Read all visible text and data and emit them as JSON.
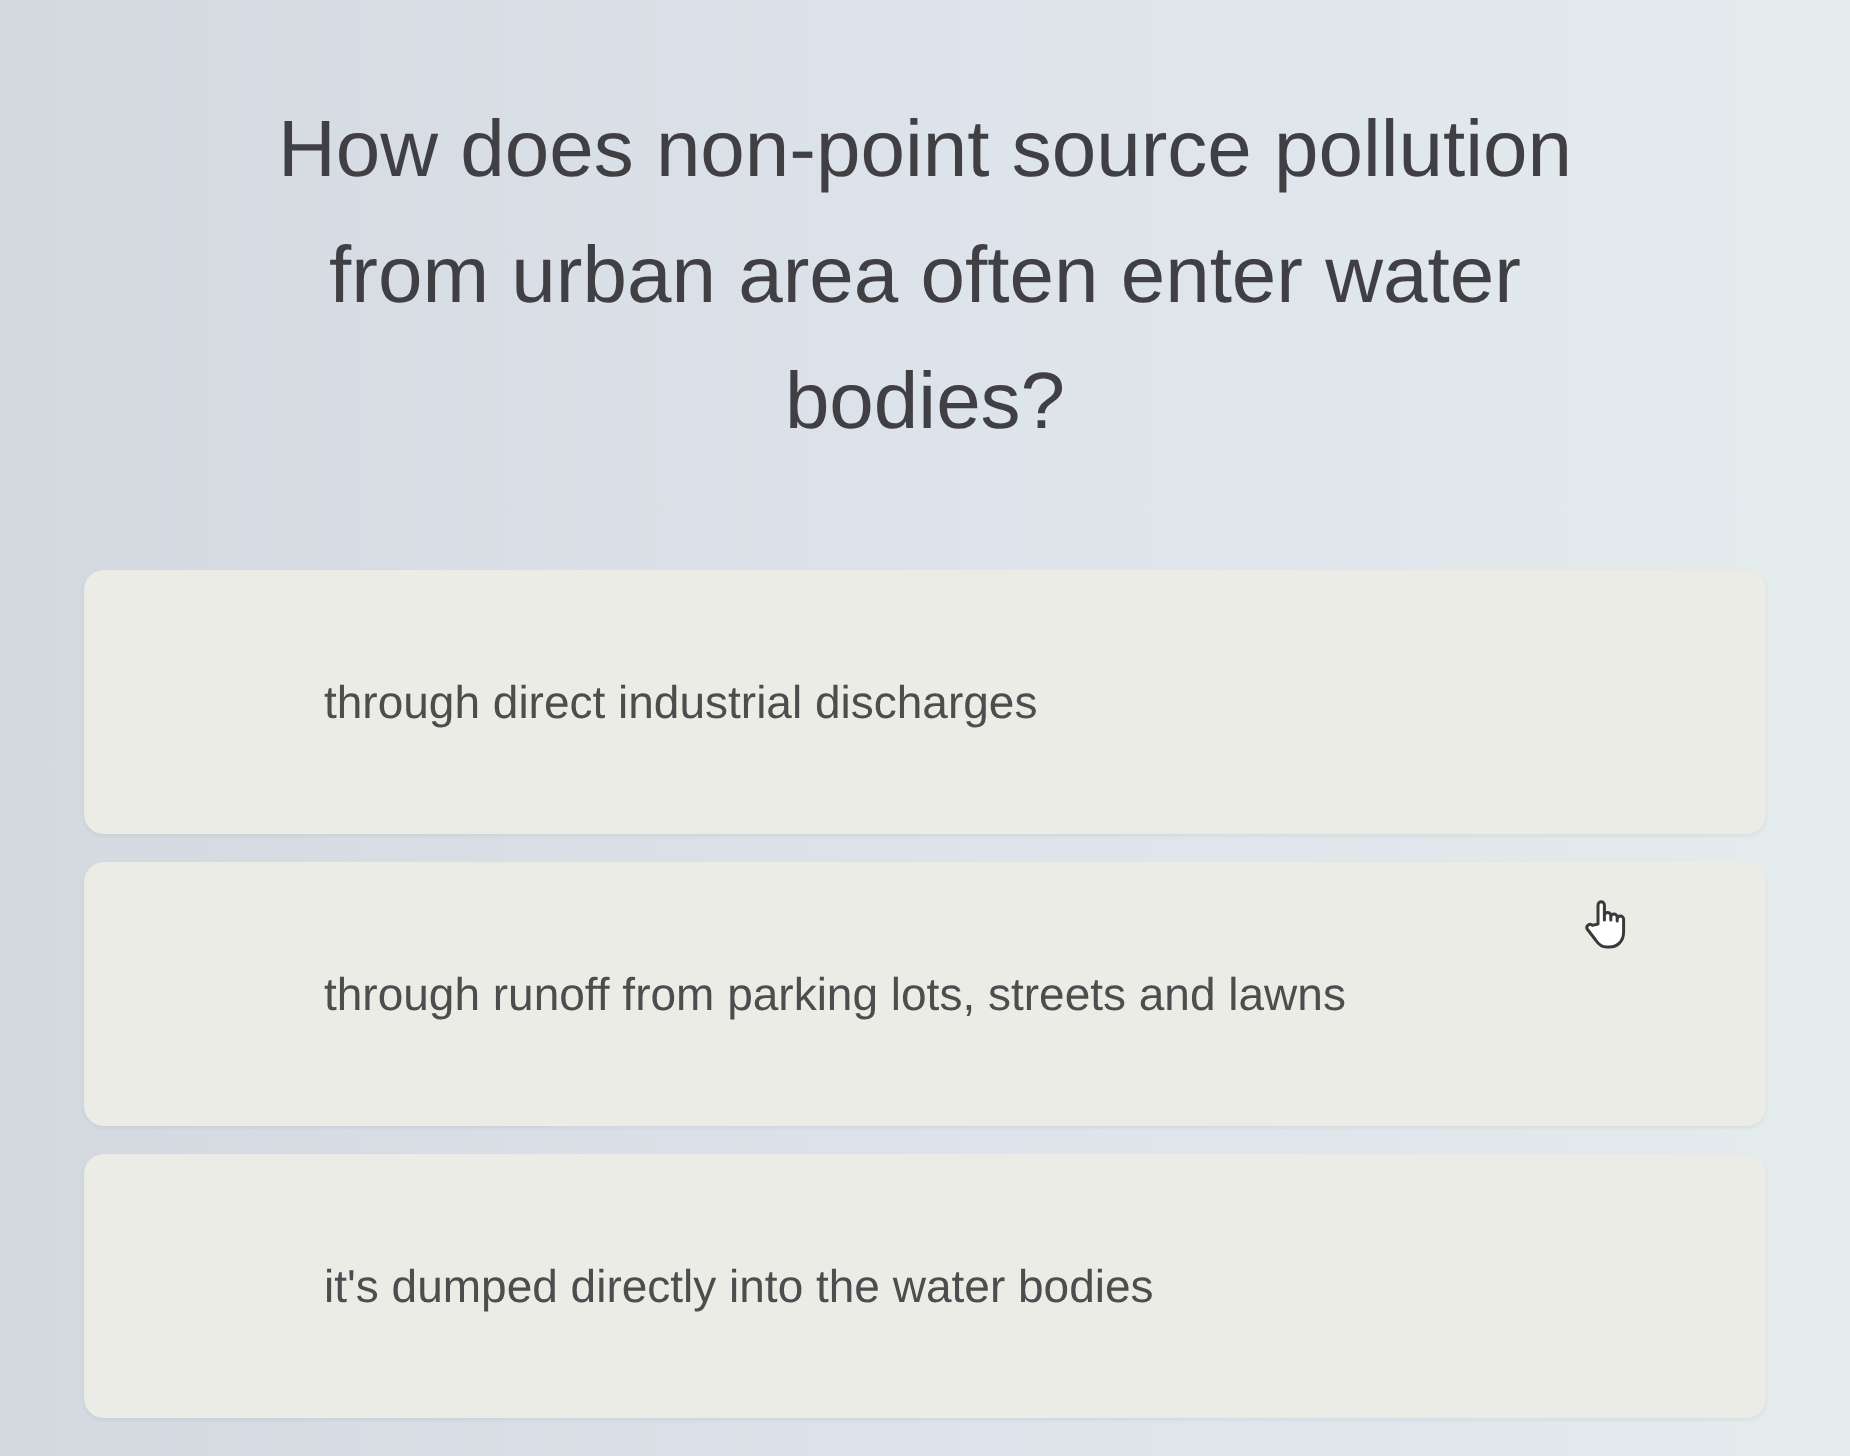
{
  "question": "How does non-point source pollution from urban area often enter water bodies?",
  "options": [
    {
      "text": "through direct industrial discharges"
    },
    {
      "text": "through runoff from parking lots, streets and lawns"
    },
    {
      "text": "it's dumped directly into the water bodies"
    }
  ]
}
